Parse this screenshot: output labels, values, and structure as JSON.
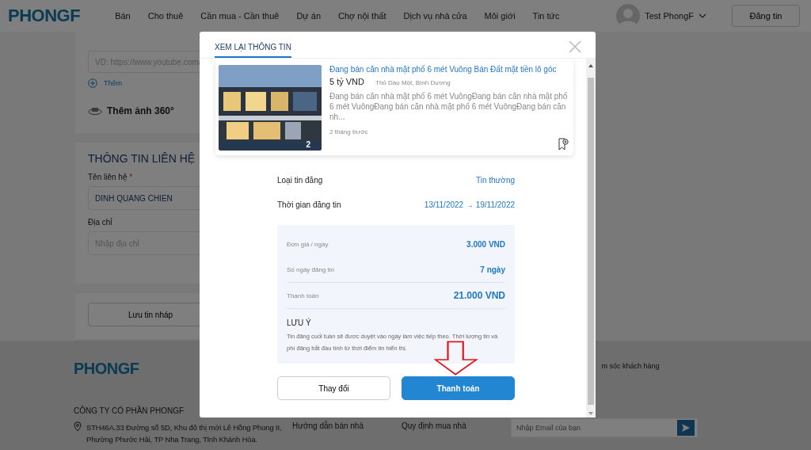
{
  "header": {
    "logo": "PHONGF",
    "nav": [
      {
        "label": "Bán"
      },
      {
        "label": "Cho thuê"
      },
      {
        "label": "Cần mua - Cần thuê"
      },
      {
        "label": "Dự án"
      },
      {
        "label": "Chợ nội thất"
      },
      {
        "label": "Dịch vụ nhà cửa"
      },
      {
        "label": "Môi giới"
      },
      {
        "label": "Tin tức"
      }
    ],
    "user": "Test PhongF",
    "post_button": "Đăng tin"
  },
  "form": {
    "video_placeholder": "VD: https://www.youtube.com/",
    "add_link": "Thêm",
    "add_360": "Thêm ảnh 360°",
    "contact_title": "THÔNG TIN LIÊN HỆ",
    "name_label": "Tên liên hệ",
    "name_required_mark": "*",
    "name_value": "DINH QUANG CHIEN",
    "address_label": "Địa chỉ",
    "address_placeholder": "Nhập địa chỉ",
    "draft_button": "Lưu tin nháp"
  },
  "footer": {
    "logo": "PHONGF",
    "support_text": "m sóc khách hàng",
    "company": "CÔNG TY CỔ PHẦN PHONGF",
    "address": "STH46A.33 Đường số 5D, Khu đô thị mới Lê Hồng Phong II, Phường Phước Hải, TP Nha Trang, Tỉnh Khánh Hòa.",
    "links": [
      "Hướng dẫn bán nhà",
      "Quy định mua nhà"
    ],
    "email_placeholder": "Nhập Email của bạn"
  },
  "modal": {
    "tab": "XEM LẠI THÔNG TIN",
    "listing": {
      "kind": "picture",
      "title": "Đang bán căn nhà mặt phố 6 mét Vuông Bán Đất mặt tiền lô góc",
      "photo_count": "2",
      "price": "5 tỷ VND",
      "location": "Thủ Dầu Một, Bình Dương",
      "description": "Đang bán căn nhà mặt phố 6 mét VuôngĐang bán căn nhà mặt phố 6 mét VuôngĐang bán căn nhà mặt phố 6 mét VuôngĐang bán căn nh...",
      "time": "2 tháng trước"
    },
    "summary": [
      {
        "label": "Loại tin đăng",
        "value": "Tin thường"
      },
      {
        "label": "Thời gian đăng tin",
        "value": "13/11/2022 → 19/11/2022"
      }
    ],
    "costs": [
      {
        "label": "Đơn giá / ngày",
        "value": "3.000 VND",
        "total": false
      },
      {
        "label": "Số ngày đăng tin",
        "value": "7 ngày",
        "total": false
      },
      {
        "label": "Thanh toán",
        "value": "21.000 VND",
        "total": true
      }
    ],
    "note_title": "LƯU Ý",
    "note": "Tin đăng cuối tuần sẽ được duyệt vào ngày làm việc tiếp theo. Thời lượng tin và phí đăng bắt đầu tính từ thời điểm tin hiển thị.",
    "buttons": [
      {
        "label": "Thay đổi",
        "primary": false
      },
      {
        "label": "Thanh toán",
        "primary": true
      }
    ]
  }
}
